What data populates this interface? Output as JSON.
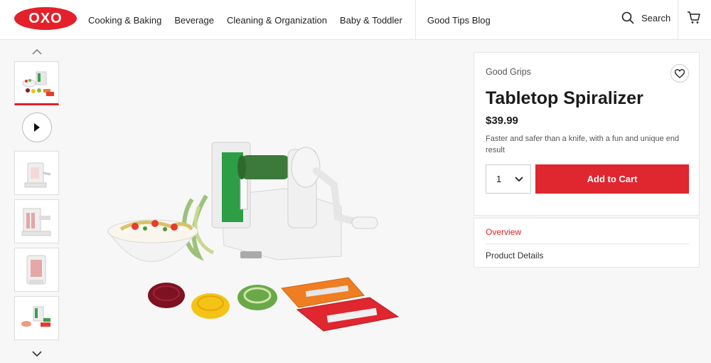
{
  "header": {
    "logo_text": "OXO",
    "nav": [
      "Cooking & Baking",
      "Beverage",
      "Cleaning & Organization",
      "Baby & Toddler"
    ],
    "blog": "Good Tips Blog",
    "search_label": "Search"
  },
  "product": {
    "brand": "Good Grips",
    "title": "Tabletop Spiralizer",
    "price": "$39.99",
    "description": "Faster and safer than a knife, with a fun and unique end result",
    "quantity": "1",
    "add_to_cart": "Add to Cart"
  },
  "tabs": [
    "Overview",
    "Product Details"
  ],
  "colors": {
    "brand_red": "#e4202a",
    "button_red": "#e0262f"
  },
  "icons": [
    "search-icon",
    "cart-icon",
    "heart-icon",
    "chevron-up-icon",
    "chevron-down-icon",
    "play-icon"
  ]
}
